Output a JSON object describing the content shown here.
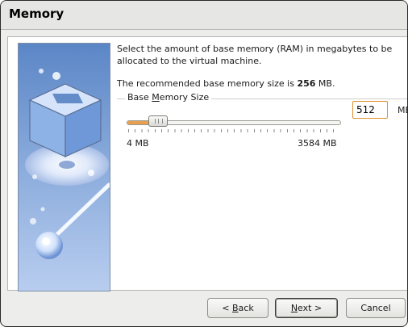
{
  "dialog": {
    "title": "Memory"
  },
  "content": {
    "description": "Select the amount of base memory (RAM) in megabytes to be allocated to the virtual machine.",
    "recommended_prefix": "The recommended base memory size is ",
    "recommended_value": "256",
    "recommended_suffix": " MB."
  },
  "memory_group": {
    "legend_before": "Base ",
    "legend_mnemonic": "M",
    "legend_after": "emory Size",
    "slider_min_label": "4 MB",
    "slider_max_label": "3584 MB",
    "slider_fraction": 0.14,
    "value": "512",
    "unit": "MB"
  },
  "buttons": {
    "back": {
      "before": "< ",
      "mnemonic": "B",
      "after": "ack"
    },
    "next": {
      "mnemonic": "N",
      "after": "ext >"
    },
    "cancel": "Cancel"
  },
  "colors": {
    "accent": "#e0912f",
    "slider_fill": "#e8a050",
    "art_background": "#6f95cf"
  },
  "icons": {
    "wizard_art": "virtualbox-cube-illustration"
  }
}
